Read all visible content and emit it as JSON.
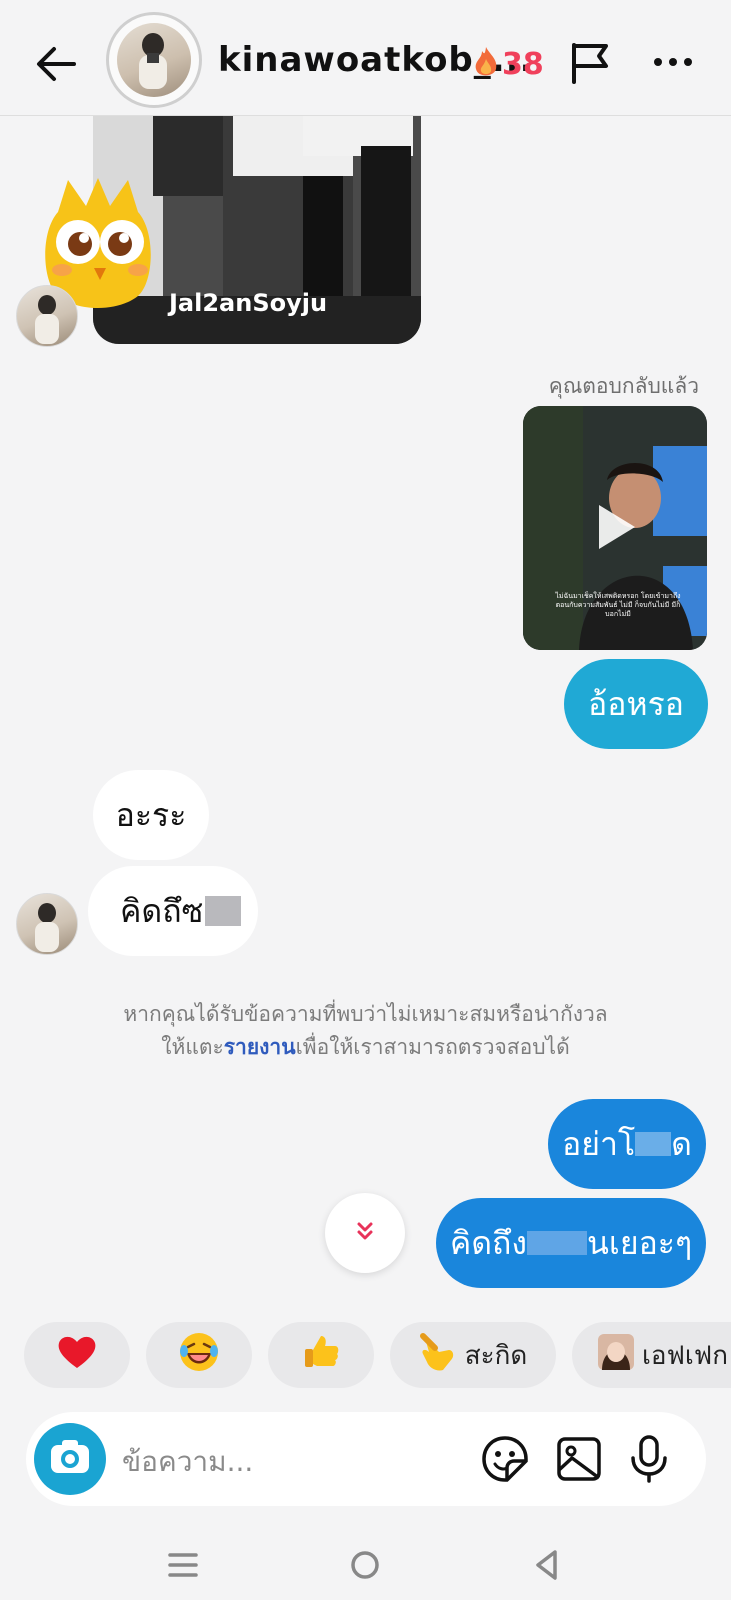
{
  "header": {
    "username": "kinawoatkob_...",
    "streak_count": "38",
    "icons": {
      "back": "back-arrow-icon",
      "fire": "fire-icon",
      "flag": "flag-icon",
      "more": "more-icon"
    }
  },
  "thread": {
    "story_card": {
      "username": "Jal2anSoyju"
    },
    "replied_label": "คุณตอบกลับแล้ว",
    "video_caption": "ไม่ฉันมาเช็คให้เสพติดหรอก โดยเข้ามาถึงตอนกับความสัมพันธ์ ไม่มี ก็จบกันไม่มี มีก็บอกไม่มี",
    "messages": [
      {
        "id": "m1",
        "from": "me",
        "text": "อ้อหรอ"
      },
      {
        "id": "m2",
        "from": "them",
        "text": "อะระ"
      },
      {
        "id": "m3",
        "from": "them",
        "text": "คิดถึซ"
      },
      {
        "id": "m4",
        "from": "me",
        "text": "อย่าโ"
      },
      {
        "id": "m5",
        "from": "me",
        "text_start": "คิดถึง",
        "text_end": "นเยอะๆ"
      }
    ],
    "m4_tail": "ด",
    "notice": {
      "line1": "หากคุณได้รับข้อความที่พบว่าไม่เหมาะสมหรือน่ากังวล",
      "line2_prefix": "ให้แตะ",
      "line2_link": "รายงาน",
      "line2_suffix": "เพื่อให้เราสามารถตรวจสอบได้"
    }
  },
  "reactions": [
    {
      "icon": "heart-icon",
      "label": ""
    },
    {
      "icon": "laughing-face-icon",
      "label": ""
    },
    {
      "icon": "thumbs-up-icon",
      "label": ""
    },
    {
      "icon": "pointing-hand-icon",
      "label": "สะกิด"
    },
    {
      "icon": "effect-avatar-icon",
      "label": "เอฟเฟก"
    }
  ],
  "composer": {
    "placeholder": "ข้อความ...",
    "icons": [
      "camera-icon",
      "sticker-icon",
      "gallery-icon",
      "microphone-icon"
    ]
  },
  "colors": {
    "outgoing_bubble": "#20a9d5",
    "outgoing_bubble_dark": "#1a86dc",
    "incoming_bubble": "#ffffff",
    "streak_red": "#f0405b",
    "link_blue": "#2f5bbd"
  }
}
